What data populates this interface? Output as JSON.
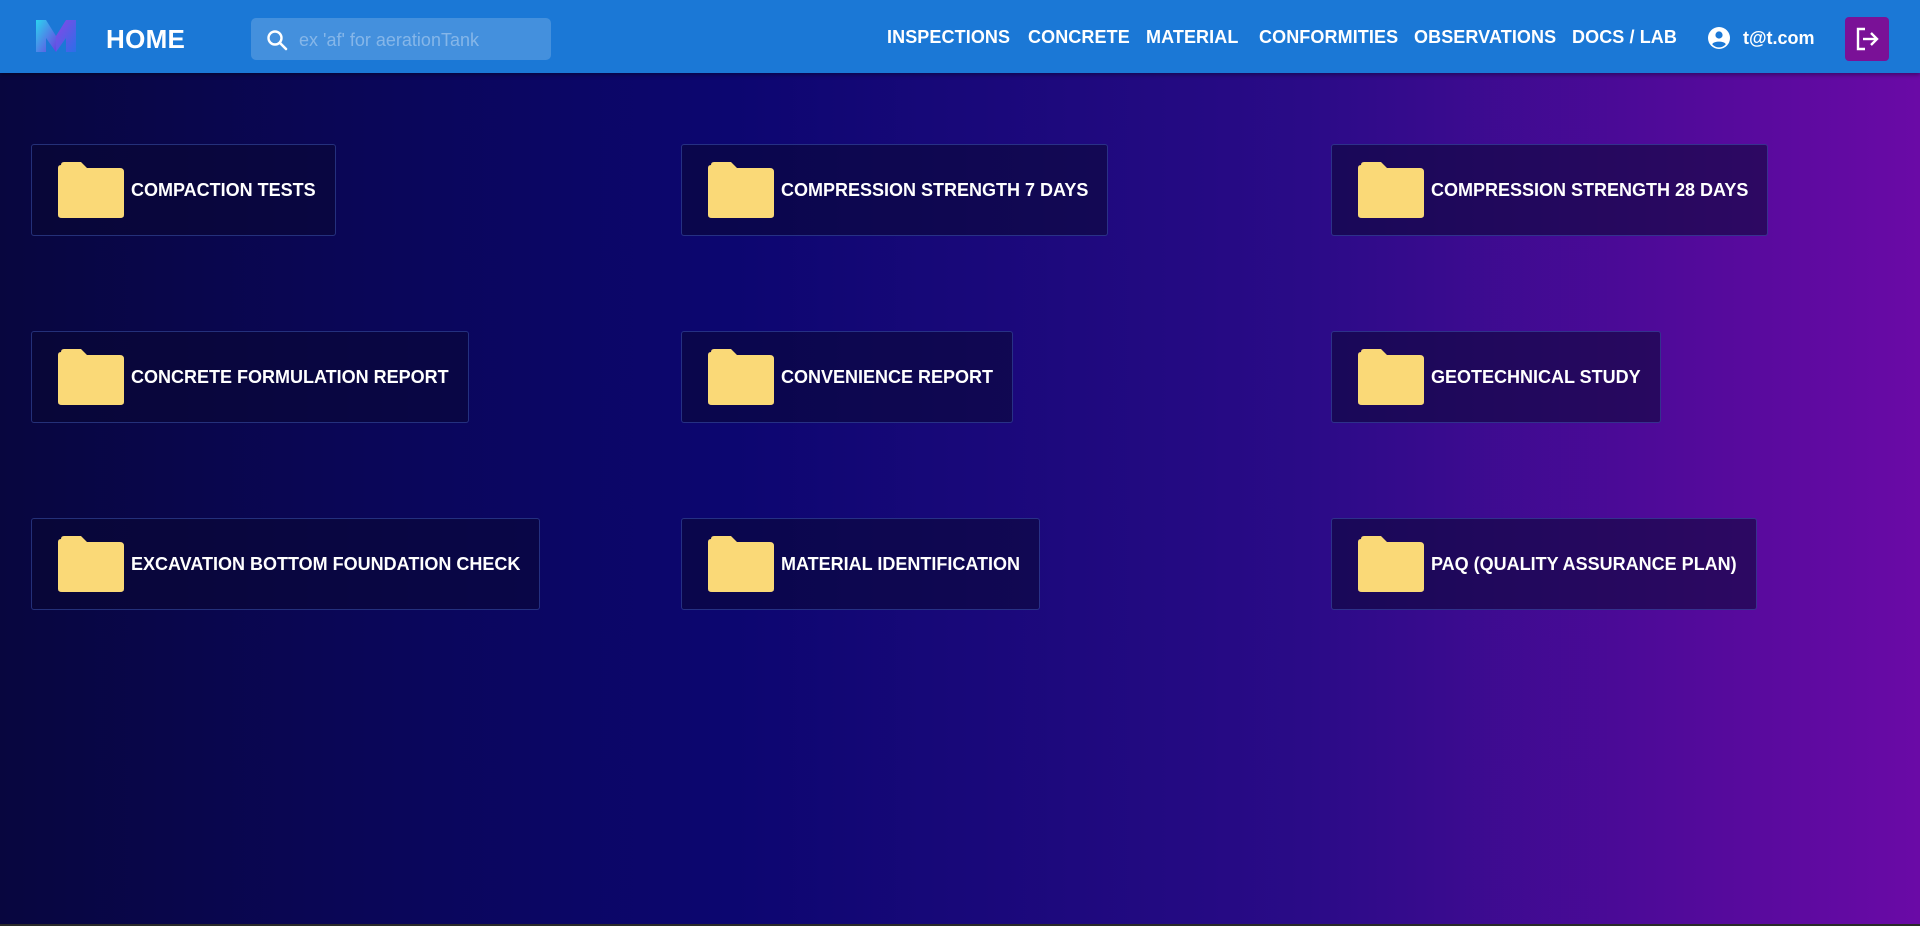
{
  "appbar": {
    "title": "HOME",
    "search": {
      "placeholder": "ex 'af' for aerationTank",
      "value": ""
    },
    "nav": [
      "INSPECTIONS",
      "CONCRETE",
      "MATERIAL",
      "CONFORMITIES",
      "OBSERVATIONS",
      "DOCS / LAB"
    ],
    "user": "t@t.com"
  },
  "folders": [
    "COMPACTION TESTS",
    "COMPRESSION STRENGTH 7 DAYS",
    "COMPRESSION STRENGTH 28 DAYS",
    "CONCRETE FORMULATION REPORT",
    "CONVENIENCE REPORT",
    "GEOTECHNICAL STUDY",
    "EXCAVATION BOTTOM FOUNDATION CHECK",
    "MATERIAL IDENTIFICATION",
    "PAQ (QUALITY ASSURANCE PLAN)"
  ],
  "icons": {
    "logo": "m-logo",
    "search": "search-icon",
    "user": "account-circle-icon",
    "logout": "logout-icon",
    "folder": "folder-icon"
  },
  "colors": {
    "appbar": "#1b78d6",
    "logout": "#7a1197",
    "folder": "#fad977"
  }
}
